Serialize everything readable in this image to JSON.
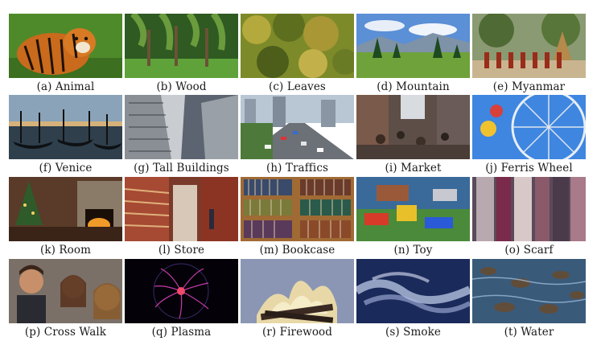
{
  "figure": {
    "panels": [
      {
        "label": "(a) Animal"
      },
      {
        "label": "(b) Wood"
      },
      {
        "label": "(c) Leaves"
      },
      {
        "label": "(d) Mountain"
      },
      {
        "label": "(e) Myanmar"
      },
      {
        "label": "(f) Venice"
      },
      {
        "label": "(g) Tall Buildings"
      },
      {
        "label": "(h) Traffics"
      },
      {
        "label": "(i) Market"
      },
      {
        "label": "(j) Ferris Wheel"
      },
      {
        "label": "(k) Room"
      },
      {
        "label": "(l) Store"
      },
      {
        "label": "(m) Bookcase"
      },
      {
        "label": "(n) Toy"
      },
      {
        "label": "(o) Scarf"
      },
      {
        "label": "(p) Cross Walk"
      },
      {
        "label": "(q) Plasma"
      },
      {
        "label": "(r) Firewood"
      },
      {
        "label": "(s) Smoke"
      },
      {
        "label": "(t) Water"
      }
    ]
  }
}
